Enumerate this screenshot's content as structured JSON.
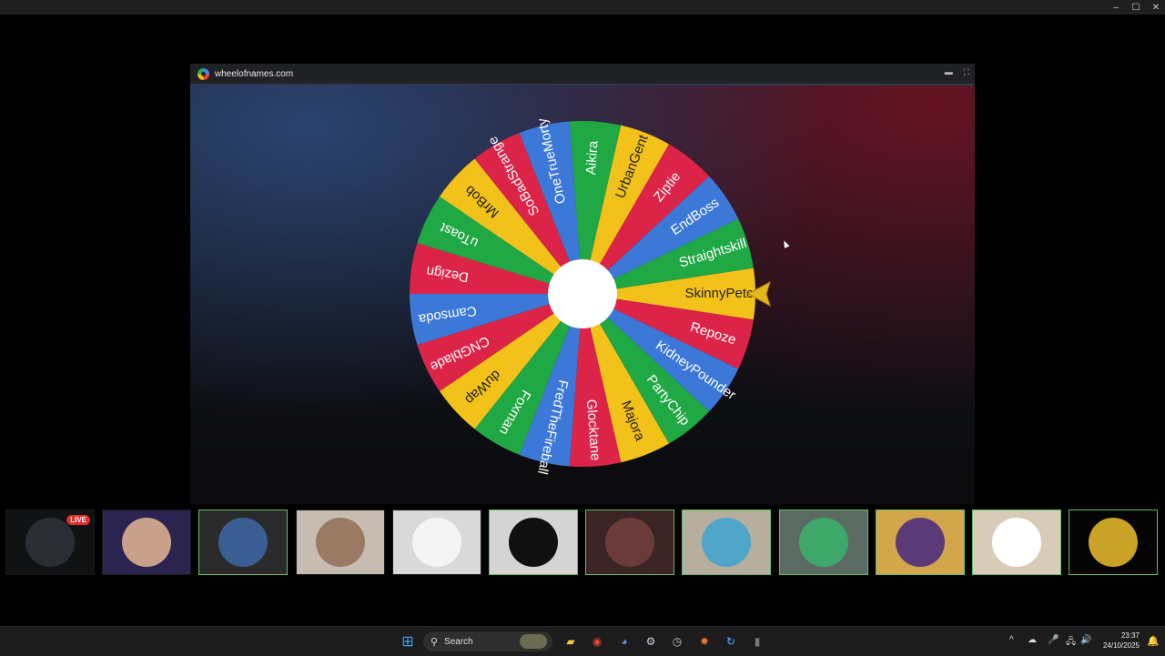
{
  "os_window": {
    "controls": [
      "–",
      "☐",
      "✕"
    ]
  },
  "share": {
    "url": "wheelofnames.com",
    "icons": [
      "folder-icon",
      "fullscreen-icon"
    ],
    "folder_glyph": "▬",
    "fullscreen_glyph": "⛶"
  },
  "wheel": {
    "winner": "SkinnyPetc",
    "segments": [
      {
        "label": "SkinnyPetc",
        "color": "#f2c21b"
      },
      {
        "label": "Repoze",
        "color": "#dc2448"
      },
      {
        "label": "KidneyPounder",
        "color": "#3c78d8"
      },
      {
        "label": "PartyChip",
        "color": "#1fa843"
      },
      {
        "label": "Majora",
        "color": "#f2c21b"
      },
      {
        "label": "Glocktane",
        "color": "#dc2448"
      },
      {
        "label": "FredTheFireball",
        "color": "#3c78d8"
      },
      {
        "label": "Foxman",
        "color": "#1fa843"
      },
      {
        "label": "duWap",
        "color": "#f2c21b"
      },
      {
        "label": "CNGblade",
        "color": "#dc2448"
      },
      {
        "label": "Camsoda",
        "color": "#3c78d8"
      },
      {
        "label": "Dezign",
        "color": "#dc2448"
      },
      {
        "label": "uToast",
        "color": "#1fa843"
      },
      {
        "label": "MrBob",
        "color": "#f2c21b"
      },
      {
        "label": "SoBadStrange",
        "color": "#dc2448"
      },
      {
        "label": "OneTrueMorty",
        "color": "#3c78d8"
      },
      {
        "label": "Aikira",
        "color": "#1fa843"
      },
      {
        "label": "UrbanGent",
        "color": "#f2c21b"
      },
      {
        "label": "Ziptie",
        "color": "#dc2448"
      },
      {
        "label": "EndBoss",
        "color": "#3c78d8"
      },
      {
        "label": "Straightskill",
        "color": "#1fa843"
      }
    ]
  },
  "participants": {
    "live_label": "LIVE",
    "tiles": [
      {
        "id": "screen-share",
        "bg": "#111214",
        "avatar": "#2a2d33",
        "speaking": false
      },
      {
        "id": "user-2",
        "bg": "#2b2450",
        "avatar": "#c9a08a",
        "speaking": false
      },
      {
        "id": "user-3",
        "bg": "#2a2a2a",
        "avatar": "#3a5d94",
        "speaking": true
      },
      {
        "id": "user-4",
        "bg": "#c7bcb1",
        "avatar": "#9a7a63",
        "speaking": false
      },
      {
        "id": "user-5",
        "bg": "#d9d9d9",
        "avatar": "#f4f4f4",
        "speaking": false
      },
      {
        "id": "user-6",
        "bg": "#d4d4d4",
        "avatar": "#101010",
        "speaking": true
      },
      {
        "id": "user-7",
        "bg": "#3a2424",
        "avatar": "#6b3a3a",
        "speaking": true
      },
      {
        "id": "user-8",
        "bg": "#b7ae9e",
        "avatar": "#4fa6c9",
        "speaking": true
      },
      {
        "id": "user-9",
        "bg": "#5b6b64",
        "avatar": "#3ea86a",
        "speaking": true
      },
      {
        "id": "user-10",
        "bg": "#d3a64c",
        "avatar": "#5a3b78",
        "speaking": true
      },
      {
        "id": "user-11",
        "bg": "#d8ccb8",
        "avatar": "#ffffff",
        "speaking": true
      },
      {
        "id": "user-12",
        "bg": "#050505",
        "avatar": "#c9a227",
        "speaking": true
      }
    ]
  },
  "taskbar": {
    "search_label": "Search",
    "time": "23:37",
    "date": "24/10/2025",
    "apps": [
      {
        "name": "start-icon",
        "glyph": "⊞",
        "color": "#3aa0ff"
      },
      {
        "name": "file-explorer-icon",
        "glyph": "▰",
        "color": "#f5c542"
      },
      {
        "name": "chrome-icon",
        "glyph": "◉",
        "color": "#e94235"
      },
      {
        "name": "discord-icon",
        "glyph": "◕",
        "color": "#7289da"
      },
      {
        "name": "steam-icon",
        "glyph": "⚙",
        "color": "#cfd8e3"
      },
      {
        "name": "clock-app-icon",
        "glyph": "◷",
        "color": "#cccccc"
      },
      {
        "name": "game-app-icon",
        "glyph": "✸",
        "color": "#e5792b"
      },
      {
        "name": "refresh-app-icon",
        "glyph": "↻",
        "color": "#5aa9ff"
      },
      {
        "name": "misc-app-icon",
        "glyph": "▮",
        "color": "#777777"
      }
    ],
    "tray": [
      "^",
      "☁",
      "🎤",
      "🖧",
      "🔊"
    ]
  }
}
